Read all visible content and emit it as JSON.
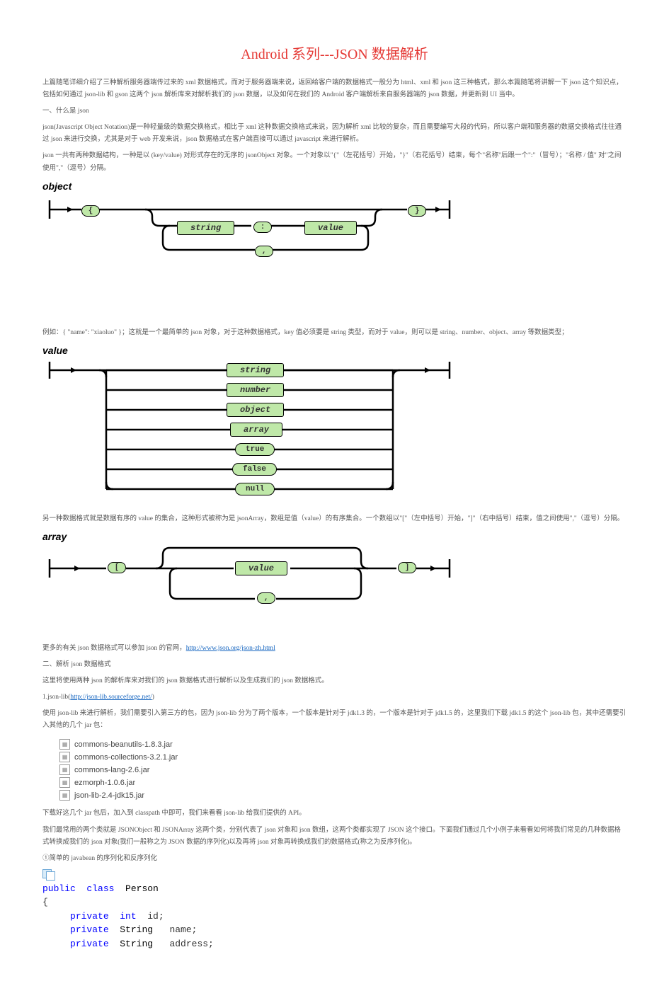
{
  "title": "Android 系列---JSON 数据解析",
  "para1": "上篇随笔详细介绍了三种解析服务器端传过来的 xml 数据格式，而对于服务器端来说，返回给客户端的数据格式一般分为 html、xml 和 json 这三种格式，那么本篇随笔将讲解一下 json 这个知识点，包括如何通过 json-lib 和 gson 这两个 json 解析库来对解析我们的 json 数据，以及如何在我们的 Android 客户端解析来自服务器端的 json 数据，并更新到 UI 当中。",
  "heading1": "一、什么是 json",
  "para2": "json(Javascript Object Notation)是一种轻量级的数据交换格式，相比于 xml 这种数据交换格式来说，因为解析 xml 比较的复杂，而且需要编写大段的代码，所以客户端和服务器的数据交换格式往往通过 json 来进行交换，尤其是对于 web 开发来说，json 数据格式在客户端直接可以通过 javascript 来进行解析。",
  "para3": "json 一共有两种数据结构，一种是以 (key/value) 对形式存在的无序的 jsonObject 对象。一个对象以\"{\"（左花括号）开始，\"}\"（右花括号）结束，每个\"名称\"后跟一个\":\"（冒号）；\"名称 / 值\" 对\"之间使用\",\"（逗号）分隔。",
  "diag1": {
    "title": "object",
    "lbrace": "{",
    "str": "string",
    "colon": ":",
    "val": "value",
    "rbrace": "}",
    "comma": ","
  },
  "para4": "例如：{ \"name\": \"xiaoluo\" }；这就是一个最简单的 json 对象，对于这种数据格式，key 值必须要是 string 类型，而对于 value，则可以是 string、number、object、array 等数据类型；",
  "diag2": {
    "title": "value",
    "opts": [
      "string",
      "number",
      "object",
      "array",
      "true",
      "false",
      "null"
    ]
  },
  "para5": "另一种数据格式就是数据有序的 value 的集合，这种形式被称为是 jsonArray，数组是值（value）的有序集合。一个数组以\"[\"（左中括号）开始，\"]\"（右中括号）结束，值之间使用\",\"（逗号）分隔。",
  "diag3": {
    "title": "array",
    "lbrk": "[",
    "val": "value",
    "rbrk": "]",
    "comma": ","
  },
  "para6_pre": "更多的有关 json 数据格式可以参加 json 的官网，",
  "link1": "http://www.json.org/json-zh.html",
  "heading2": "二、解析 json 数据格式",
  "para7": "这里将使用两种 json 的解析库来对我们的 json 数据格式进行解析以及生成我们的 json 数据格式。",
  "para8_pre": "1.json-lib(",
  "link2": "http://json-lib.sourceforge.net/",
  "para8_post": ")",
  "para9": "使用 json-lib 来进行解析，我们需要引入第三方的包，因为 json-lib 分为了两个版本，一个版本是针对于 jdk1.3 的，一个版本是针对于 jdk1.5 的，这里我们下载 jdk1.5 的这个 json-lib 包，其中还需要引入其他的几个 jar 包：",
  "jars": [
    "commons-beanutils-1.8.3.jar",
    "commons-collections-3.2.1.jar",
    "commons-lang-2.6.jar",
    "ezmorph-1.0.6.jar",
    "json-lib-2.4-jdk15.jar"
  ],
  "para10": "下载好这几个 jar 包后，加入到 classpath 中即可，我们来看看 json-lib 给我们提供的 API。",
  "para11": "我们最常用的两个类就是 JSONObject 和 JSONArray 这两个类，分别代表了 json 对象和 json 数组，这两个类都实现了 JSON 这个接口。下面我们通过几个小例子来看看如何将我们常见的几种数据格式转换成我们的 json 对象(我们一般称之为 JSON 数据的序列化)以及再将 json 对象再转换成我们的数据格式(称之为反序列化)。",
  "para12": "①简单的 javabean 的序列化和反序列化",
  "code": {
    "l1": {
      "k1": "public",
      "k2": "class",
      "cl": "Person"
    },
    "l2": "{",
    "l3": {
      "k1": "private",
      "k2": "int",
      "n": "id;"
    },
    "l4": {
      "k1": "private",
      "t": "String",
      "n": "name;"
    },
    "l5": {
      "k1": "private",
      "t": "String",
      "n": "address;"
    }
  }
}
